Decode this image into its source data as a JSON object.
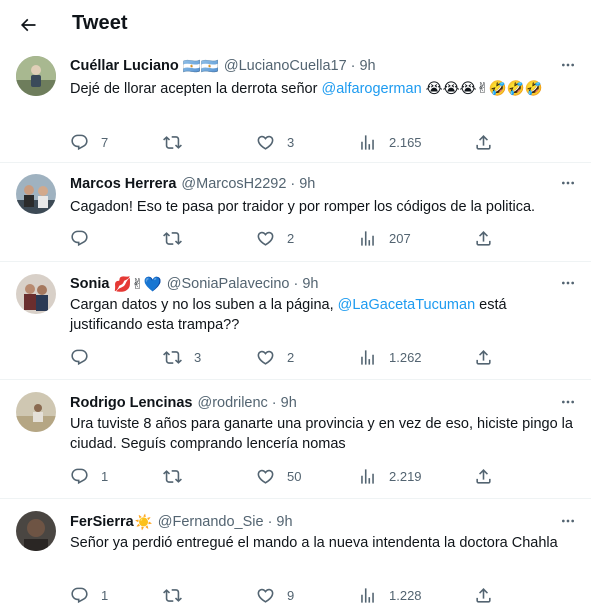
{
  "header": {
    "title": "Tweet"
  },
  "tweets": [
    {
      "name": "Cuéllar Luciano",
      "badge_emoji": "🇦🇷🇦🇷",
      "handle": "@LucianoCuella17",
      "time": "9h",
      "text_before": "Dejé de llorar acepten la derrota señor ",
      "mention": "@alfarogerman",
      "text_after": " 😭😭😭✌🤣🤣🤣",
      "replies": "7",
      "retweets": "",
      "likes": "3",
      "views": "2.165",
      "avatar_color": "#7b8a6a"
    },
    {
      "name": "Marcos Herrera",
      "badge_emoji": "",
      "handle": "@MarcosH2292",
      "time": "9h",
      "text_before": "Cagadon! Eso te pasa por traidor y por romper los códigos de la politica.",
      "mention": "",
      "text_after": "",
      "replies": "",
      "retweets": "",
      "likes": "2",
      "views": "207",
      "avatar_color": "#5a6b78"
    },
    {
      "name": "Sonia",
      "badge_emoji": "💋✌💙",
      "handle": "@SoniaPalavecino",
      "time": "9h",
      "text_before": "Cargan datos y no los suben a la página, ",
      "mention": "@LaGacetaTucuman",
      "text_after": " está justificando esta trampa??",
      "replies": "",
      "retweets": "3",
      "likes": "2",
      "views": "1.262",
      "avatar_color": "#8a6f62"
    },
    {
      "name": "Rodrigo Lencinas",
      "badge_emoji": "",
      "handle": "@rodrilenc",
      "time": "9h",
      "text_before": "Ura tuviste 8 años para ganarte una provincia y en vez de eso, hiciste pingo la ciudad. Seguís comprando lencería nomas",
      "mention": "",
      "text_after": "",
      "replies": "1",
      "retweets": "",
      "likes": "50",
      "views": "2.219",
      "avatar_color": "#a89a7e"
    },
    {
      "name": "FerSierra",
      "badge_emoji": "☀️",
      "handle": "@Fernando_Sie",
      "time": "9h",
      "text_before": "Señor ya perdió entregué el mando a la nueva intendenta la doctora Chahla",
      "mention": "",
      "text_after": "",
      "replies": "1",
      "retweets": "",
      "likes": "9",
      "views": "1.228",
      "avatar_color": "#4d4540"
    }
  ]
}
